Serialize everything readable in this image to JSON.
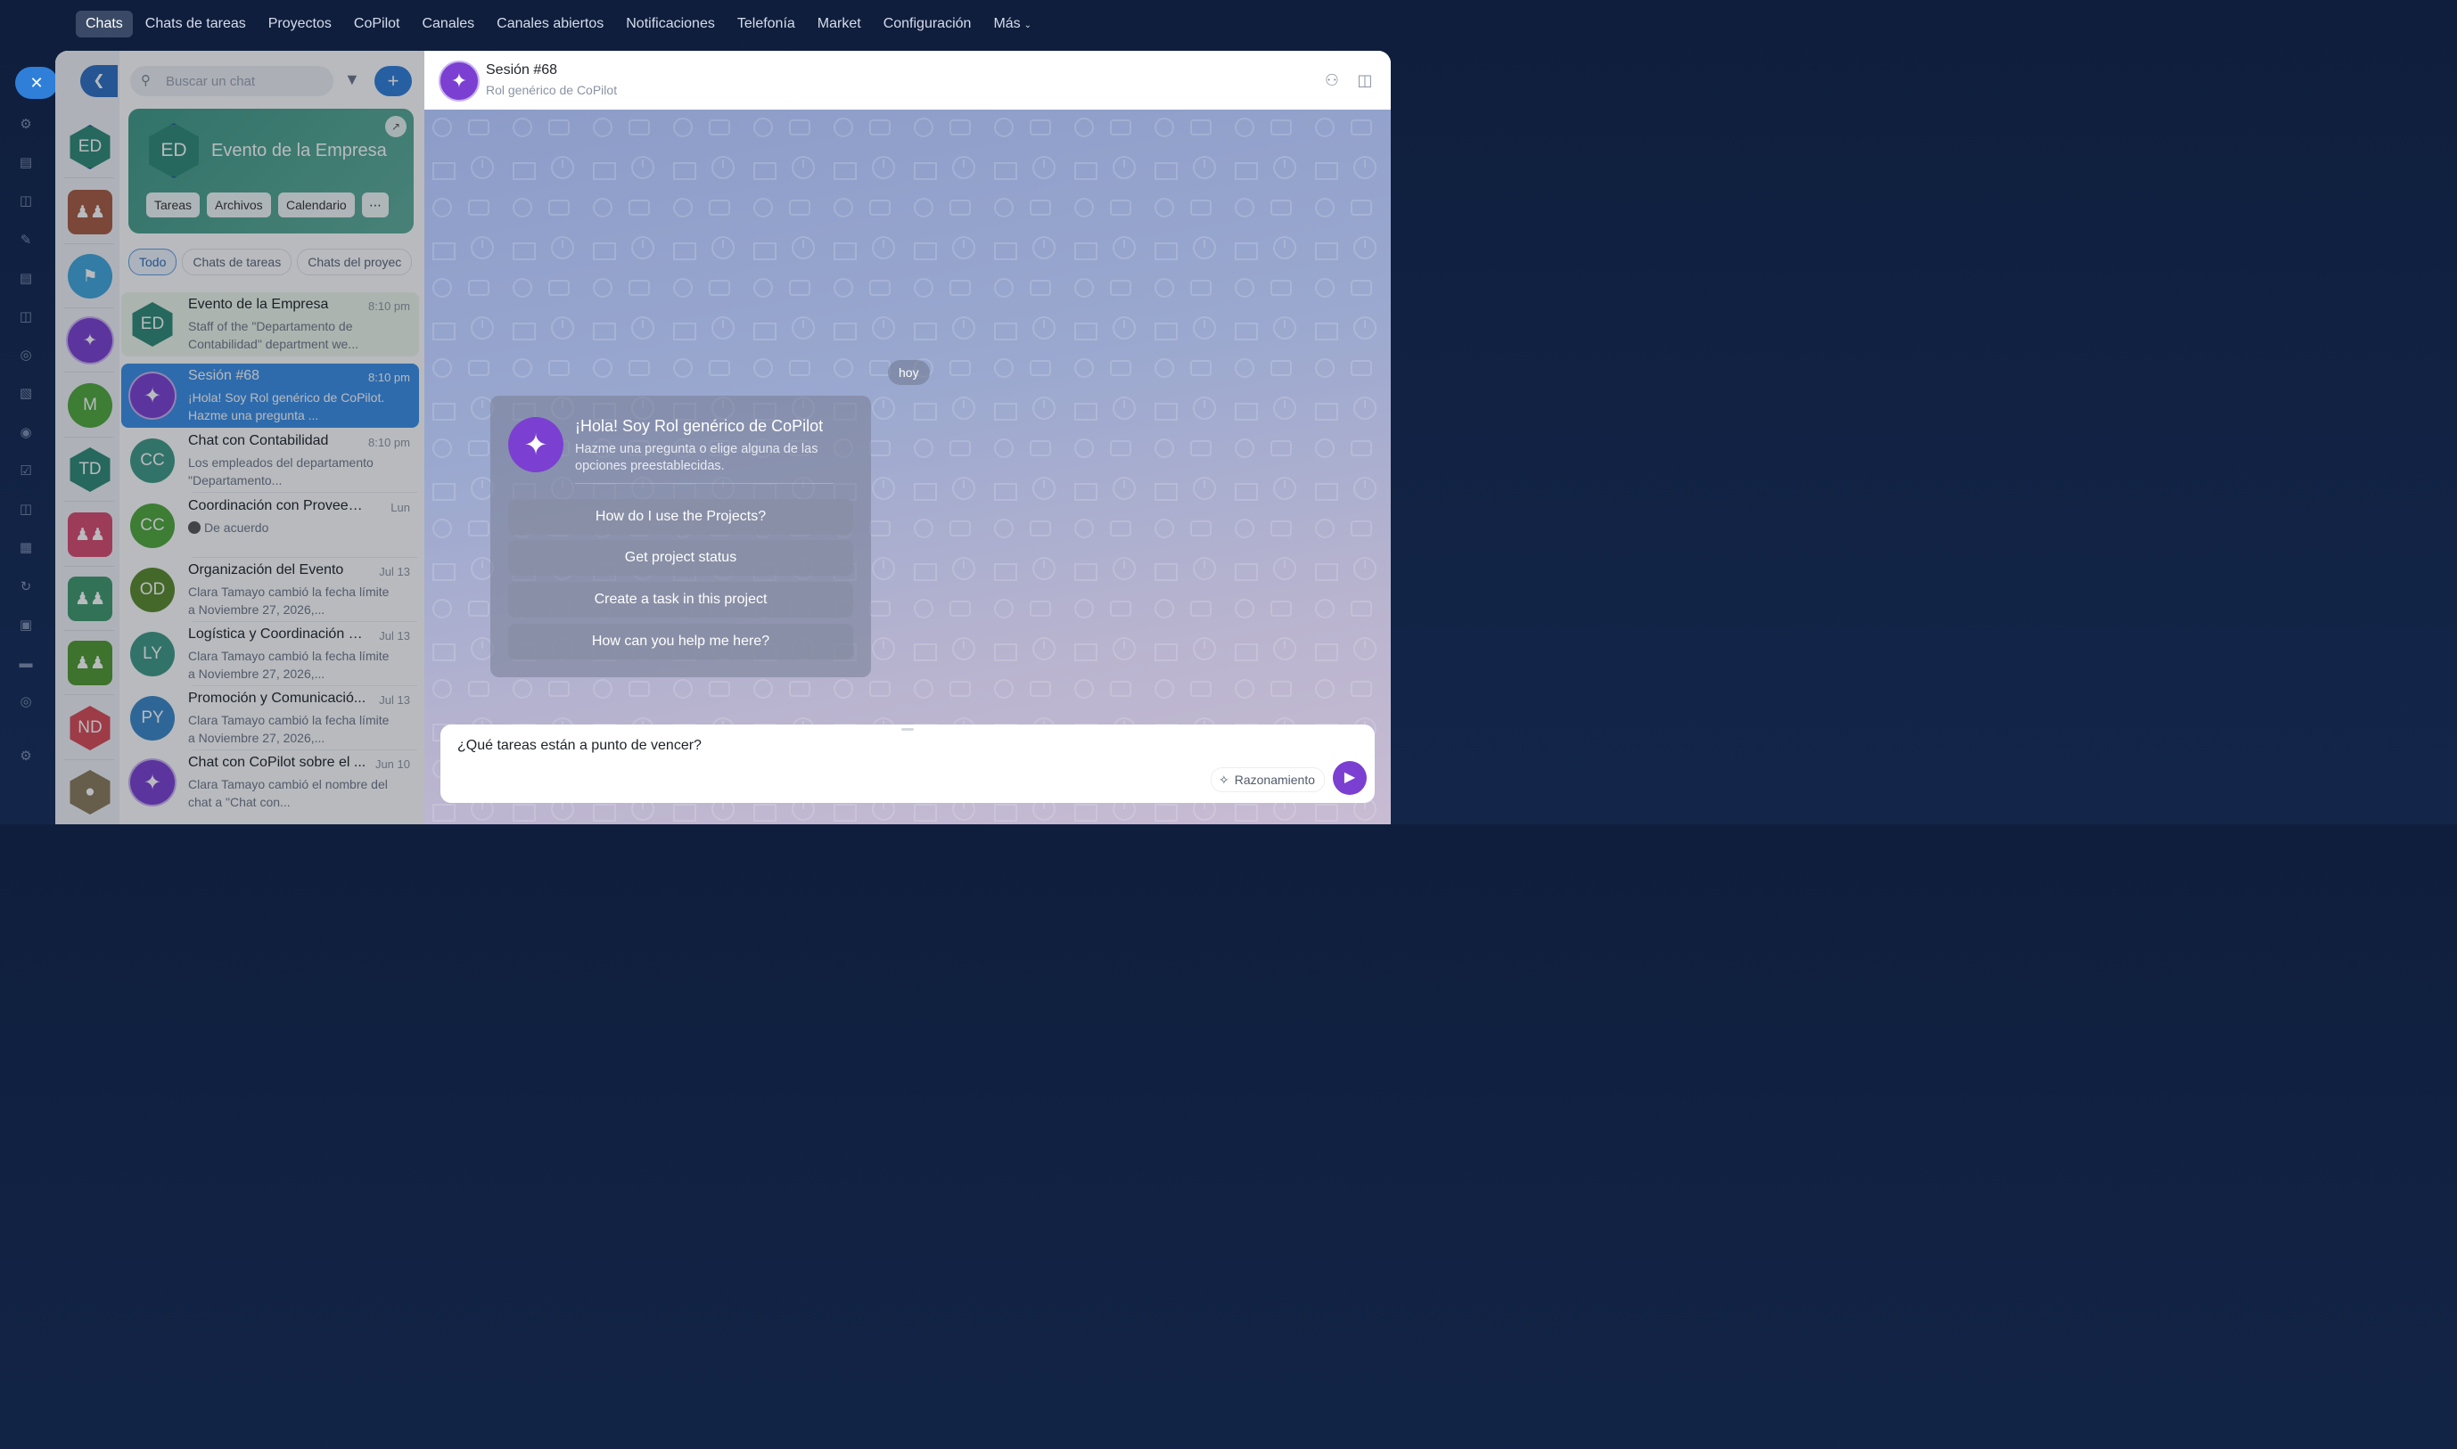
{
  "topnav": {
    "items": [
      "Chats",
      "Chats de tareas",
      "Proyectos",
      "CoPilot",
      "Canales",
      "Canales abiertos",
      "Notificaciones",
      "Telefonía",
      "Market",
      "Configuración",
      "Más"
    ]
  },
  "avatars": [
    "ED",
    "M",
    "TD",
    "ND"
  ],
  "search": {
    "placeholder": "Buscar un chat"
  },
  "group_card": {
    "initials": "ED",
    "title": "Evento de la Empresa",
    "chips": [
      "Tareas",
      "Archivos",
      "Calendario"
    ]
  },
  "filters": [
    "Todo",
    "Chats de tareas",
    "Chats del proyec"
  ],
  "chat_list": [
    {
      "initials": "ED",
      "title": "Evento de la Empresa",
      "time": "8:10 pm",
      "preview": "Staff of the \"Departamento de Contabilidad\" department we..."
    },
    {
      "initials": "",
      "title": "Sesión #68",
      "time": "8:10 pm",
      "preview": "¡Hola! Soy Rol genérico de CoPilot. Hazme una pregunta ..."
    },
    {
      "initials": "CC",
      "title": "Chat con Contabilidad",
      "time": "8:10 pm",
      "preview": "Los empleados del departamento \"Departamento..."
    },
    {
      "initials": "CC",
      "title": "Coordinación con Proveedor...",
      "time": "Lun",
      "preview": "De acuerdo"
    },
    {
      "initials": "OD",
      "title": "Organización del Evento",
      "time": "Jul 13",
      "preview": "Clara Tamayo cambió la fecha límite a Noviembre 27, 2026,..."
    },
    {
      "initials": "LY",
      "title": "Logística y Coordinación d...",
      "time": "Jul 13",
      "preview": "Clara Tamayo cambió la fecha límite a Noviembre 27, 2026,..."
    },
    {
      "initials": "PY",
      "title": "Promoción y Comunicació...",
      "time": "Jul 13",
      "preview": "Clara Tamayo cambió la fecha límite a Noviembre 27, 2026,..."
    },
    {
      "initials": "",
      "title": "Chat con CoPilot sobre el ...",
      "time": "Jun 10",
      "preview": "Clara Tamayo cambió el nombre del chat a \"Chat con..."
    }
  ],
  "chat": {
    "title": "Sesión #68",
    "subtitle": "Rol genérico de CoPilot",
    "date_label": "hoy",
    "welcome_title": "¡Hola! Soy Rol genérico de CoPilot",
    "welcome_subtitle": "Hazme una pregunta o elige alguna de las opciones preestablecidas.",
    "options": [
      "How do I use the Projects?",
      "Get project status",
      "Create a task in this project",
      "How can you help me here?"
    ],
    "composer_text": "¿Qué tareas están a punto de vencer?",
    "reasoning_label": "Razonamiento"
  }
}
